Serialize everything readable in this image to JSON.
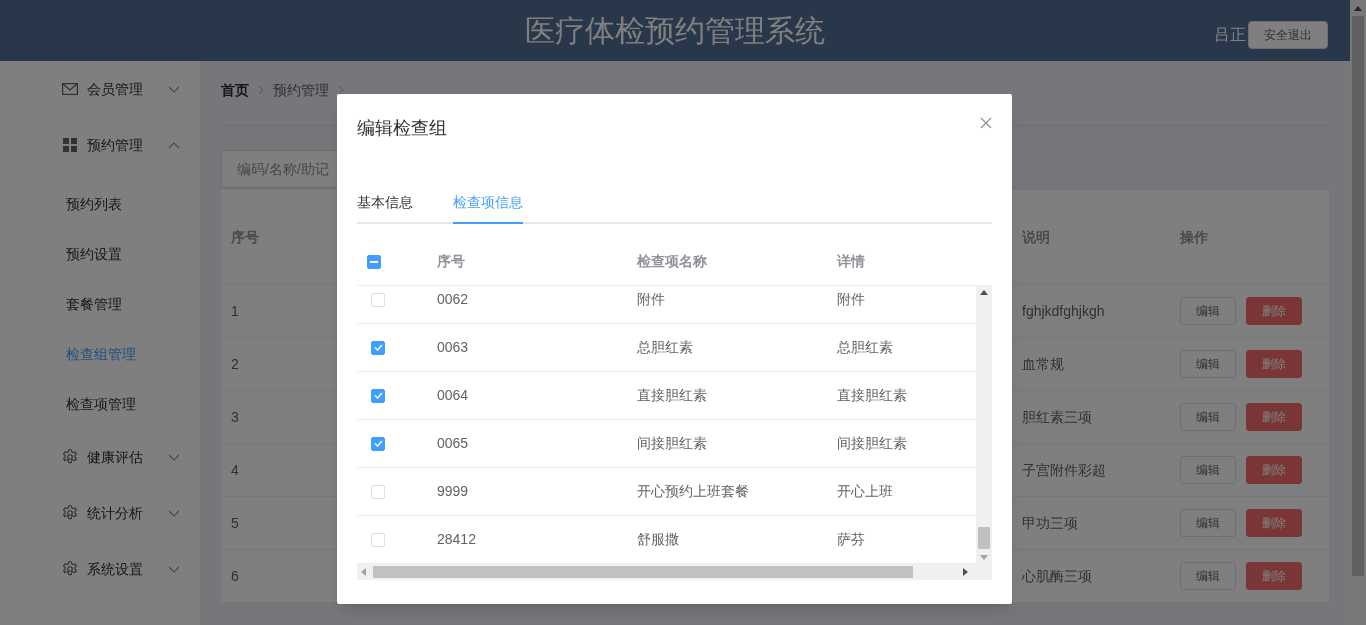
{
  "header": {
    "title": "医疗体检预约管理系统",
    "user": "吕正",
    "logout": "安全退出"
  },
  "sidebar": {
    "items": [
      {
        "label": "会员管理",
        "expanded": false
      },
      {
        "label": "预约管理",
        "expanded": true,
        "children": [
          {
            "label": "预约列表",
            "selected": false
          },
          {
            "label": "预约设置",
            "selected": false
          },
          {
            "label": "套餐管理",
            "selected": false
          },
          {
            "label": "检查组管理",
            "selected": true
          },
          {
            "label": "检查项管理",
            "selected": false
          }
        ]
      },
      {
        "label": "健康评估",
        "expanded": false
      },
      {
        "label": "统计分析",
        "expanded": false
      },
      {
        "label": "系统设置",
        "expanded": false
      }
    ]
  },
  "breadcrumb": [
    "首页",
    "预约管理"
  ],
  "search": {
    "placeholder": "编码/名称/助记"
  },
  "table": {
    "columns": [
      "序号",
      "说明",
      "操作"
    ],
    "rows": [
      {
        "index": "1",
        "description": "fghjkdfghjkgh",
        "actions": [
          {
            "label": "编辑",
            "kind": "default"
          },
          {
            "label": "删除",
            "kind": "danger"
          }
        ]
      },
      {
        "index": "2",
        "description": "血常规",
        "actions": [
          {
            "label": "编辑",
            "kind": "default"
          },
          {
            "label": "删除",
            "kind": "danger"
          }
        ]
      },
      {
        "index": "3",
        "description": "胆红素三项",
        "actions": [
          {
            "label": "编辑",
            "kind": "default"
          },
          {
            "label": "删除",
            "kind": "danger"
          }
        ]
      },
      {
        "index": "4",
        "description": "子宫附件彩超",
        "actions": [
          {
            "label": "编辑",
            "kind": "default"
          },
          {
            "label": "删除",
            "kind": "danger"
          }
        ]
      },
      {
        "index": "5",
        "description": "甲功三项",
        "actions": [
          {
            "label": "编辑",
            "kind": "default"
          },
          {
            "label": "删除",
            "kind": "danger"
          }
        ]
      },
      {
        "index": "6",
        "description": "心肌酶三项",
        "actions": [
          {
            "label": "编辑",
            "kind": "default"
          },
          {
            "label": "删除",
            "kind": "danger"
          }
        ]
      }
    ]
  },
  "dialog": {
    "title": "编辑检查组",
    "tabs": [
      {
        "label": "基本信息",
        "selected": false
      },
      {
        "label": "检查项信息",
        "selected": true
      }
    ],
    "table": {
      "select_all": {
        "indeterminate": true
      },
      "columns": [
        "序号",
        "检查项名称",
        "详情"
      ],
      "rows": [
        {
          "code": "0062",
          "name": "附件",
          "detail": "附件",
          "checked": false
        },
        {
          "code": "0063",
          "name": "总胆红素",
          "detail": "总胆红素",
          "checked": true
        },
        {
          "code": "0064",
          "name": "直接胆红素",
          "detail": "直接胆红素",
          "checked": true
        },
        {
          "code": "0065",
          "name": "间接胆红素",
          "detail": "间接胆红素",
          "checked": true
        },
        {
          "code": "9999",
          "name": "开心预约上班套餐",
          "detail": "开心上班",
          "checked": false
        },
        {
          "code": "28412",
          "name": "舒服撒",
          "detail": "萨芬",
          "checked": false
        }
      ]
    }
  }
}
